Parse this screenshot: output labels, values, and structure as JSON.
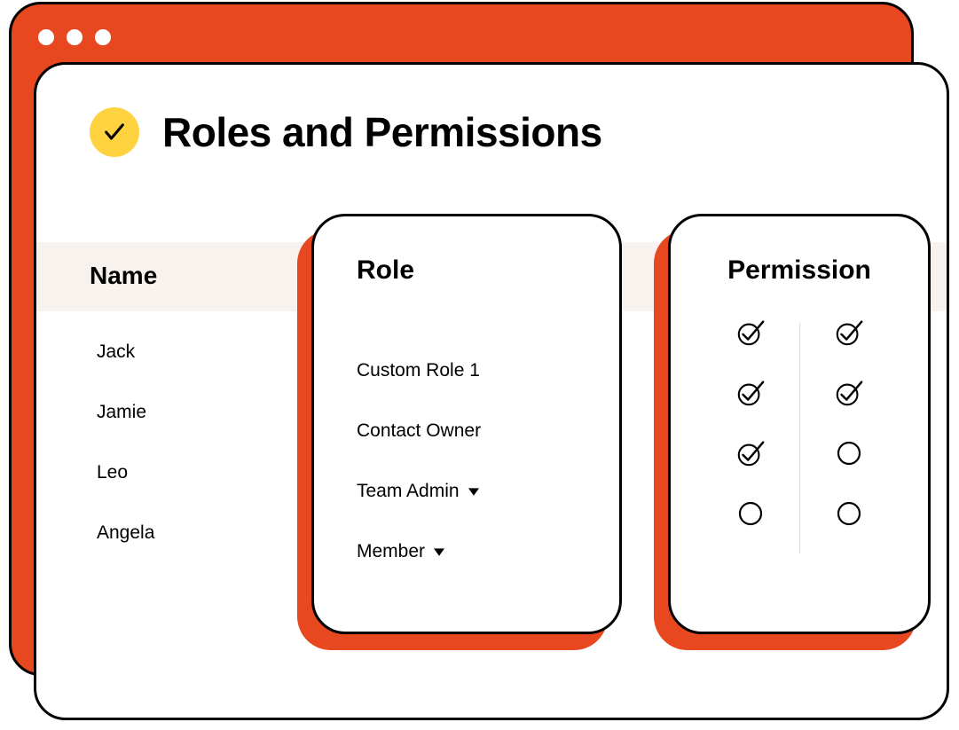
{
  "colors": {
    "accent": "#E8481F",
    "iconBg": "#FFD23F",
    "band": "#F7F2EE"
  },
  "header": {
    "title": "Roles and Permissions"
  },
  "columns": {
    "name": "Name",
    "role": "Role",
    "permission": "Permission"
  },
  "rows": [
    {
      "name": "Jack",
      "role": "Custom Role 1",
      "role_has_dropdown": false,
      "permissions": [
        true,
        true
      ]
    },
    {
      "name": "Jamie",
      "role": "Contact Owner",
      "role_has_dropdown": false,
      "permissions": [
        true,
        true
      ]
    },
    {
      "name": "Leo",
      "role": "Team Admin",
      "role_has_dropdown": true,
      "permissions": [
        true,
        false
      ]
    },
    {
      "name": "Angela",
      "role": "Member",
      "role_has_dropdown": true,
      "permissions": [
        false,
        false
      ]
    }
  ]
}
